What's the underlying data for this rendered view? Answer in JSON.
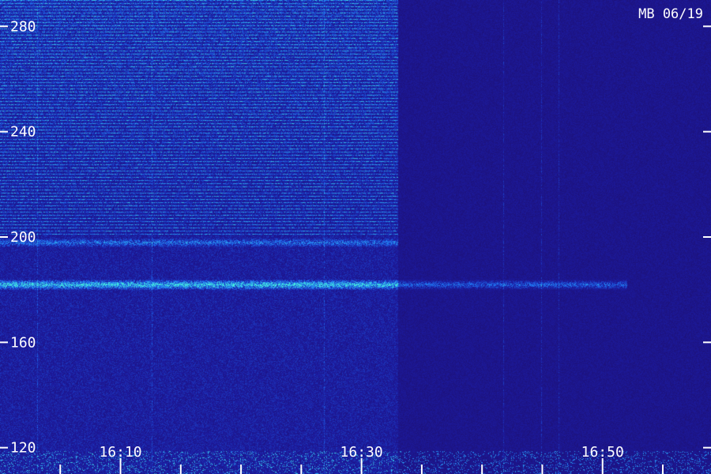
{
  "chart_data": {
    "type": "heatmap",
    "stamp": "MB 06/19",
    "y_ticks": [
      {
        "value": 120,
        "label": "120"
      },
      {
        "value": 160,
        "label": "160"
      },
      {
        "value": 200,
        "label": "200"
      },
      {
        "value": 240,
        "label": "240"
      },
      {
        "value": 280,
        "label": "280"
      }
    ],
    "x_ticks": [
      {
        "value": "16:05",
        "label": ""
      },
      {
        "value": "16:10",
        "label": "16:10"
      },
      {
        "value": "16:15",
        "label": ""
      },
      {
        "value": "16:20",
        "label": ""
      },
      {
        "value": "16:25",
        "label": ""
      },
      {
        "value": "16:30",
        "label": "16:30"
      },
      {
        "value": "16:35",
        "label": ""
      },
      {
        "value": "16:40",
        "label": ""
      },
      {
        "value": "16:45",
        "label": ""
      },
      {
        "value": "16:50",
        "label": "16:50"
      },
      {
        "value": "16:55",
        "label": ""
      }
    ],
    "ylim": [
      110,
      290
    ],
    "xlim": [
      "16:00",
      "16:59"
    ],
    "features": [
      {
        "kind": "horizontal_band",
        "y": 182,
        "intensity": "strong",
        "x_start": "16:00",
        "x_end": "16:52"
      },
      {
        "kind": "horizontal_band",
        "y": 198,
        "intensity": "medium",
        "x_start": "16:00",
        "x_end": "16:33"
      },
      {
        "kind": "noise_shift",
        "x": "16:33"
      }
    ],
    "colors": {
      "background": "#1c0f78",
      "low": "#2a1aa0",
      "mid": "#1e5ee8",
      "high": "#3fe6e0"
    }
  }
}
